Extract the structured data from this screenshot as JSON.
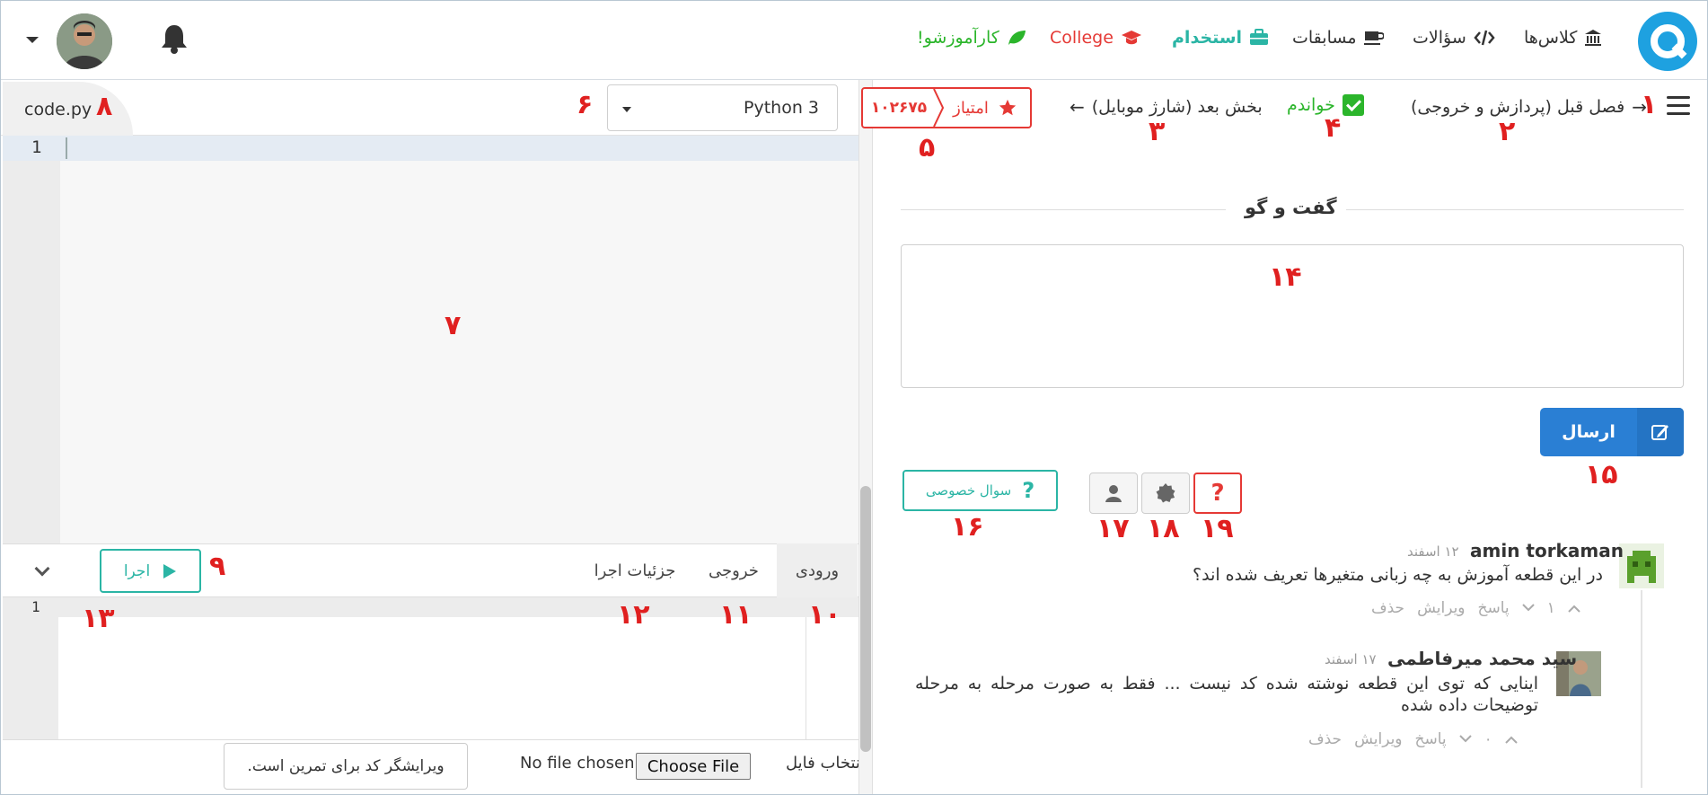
{
  "header": {
    "nav": {
      "classes": "کلاس‌ها",
      "questions": "سؤالات",
      "contests": "مسابقات",
      "jobs": "استخدام",
      "college": "College",
      "internship": "کارآموزشو!"
    },
    "icons": [
      "bank-icon",
      "code-icon",
      "coffee-icon",
      "briefcase-icon",
      "graduation-cap-icon",
      "leaf-icon",
      "bell-icon",
      "chevron-down-icon"
    ]
  },
  "editor": {
    "file_name": "code.py",
    "language": "Python 3",
    "line_numbers": [
      "1"
    ],
    "io_tabs": {
      "input": "ورودی",
      "output": "خروجی",
      "details": "جزئیات اجرا"
    },
    "run_label": "اجرا",
    "input_line_numbers": [
      "1"
    ],
    "file_label": "انتخاب فایل",
    "choose_file": "Choose File",
    "no_file": "No file chosen",
    "editor_note": "ویرایشگر کد برای تمرین است."
  },
  "lesson": {
    "prev_label": "فصل قبل (پردازش و خروجی)",
    "done_label": "خواندم",
    "next_label": "بخش بعد (شارژ موبایل)",
    "score_label": "امتیاز",
    "score_value": "۱۰۲۶۷۵"
  },
  "discussion": {
    "title": "گفت و گو",
    "send_label": "ارسال",
    "private_question": "سوال خصوصی",
    "comments": [
      {
        "name": "amin torkaman",
        "date": "۱۲ اسفند",
        "text": "در این قطعه آموزش به چه زبانی متغیرها تعریف شده اند؟",
        "votes": "۱",
        "reply": "پاسخ",
        "edit": "ویرایش",
        "delete": "حذف"
      },
      {
        "name": "سید محمد میرفاطمی",
        "date": "۱۷ اسفند",
        "text": "اینایی که توی این قطعه نوشته شده کد نیست ... فقط به صورت مرحله به مرحله توضیحات داده شده",
        "votes": "۰",
        "reply": "پاسخ",
        "edit": "ویرایش",
        "delete": "حذف"
      }
    ]
  },
  "annotations": {
    "n1": "۱",
    "n2": "۲",
    "n3": "۳",
    "n4": "۴",
    "n5": "۵",
    "n6": "۶",
    "n7": "۷",
    "n8": "۸",
    "n9": "۹",
    "n10": "۱۰",
    "n11": "۱۱",
    "n12": "۱۲",
    "n13": "۱۳",
    "n14": "۱۴",
    "n15": "۱۵",
    "n16": "۱۶",
    "n17": "۱۷",
    "n18": "۱۸",
    "n19": "۱۹"
  },
  "colors": {
    "brand": "#1ea1e0",
    "teal": "#2bb5a5",
    "red": "#e53935",
    "green": "#2bb52b",
    "send_blue": "#2a7fd4",
    "annotation_red": "#e02020"
  }
}
